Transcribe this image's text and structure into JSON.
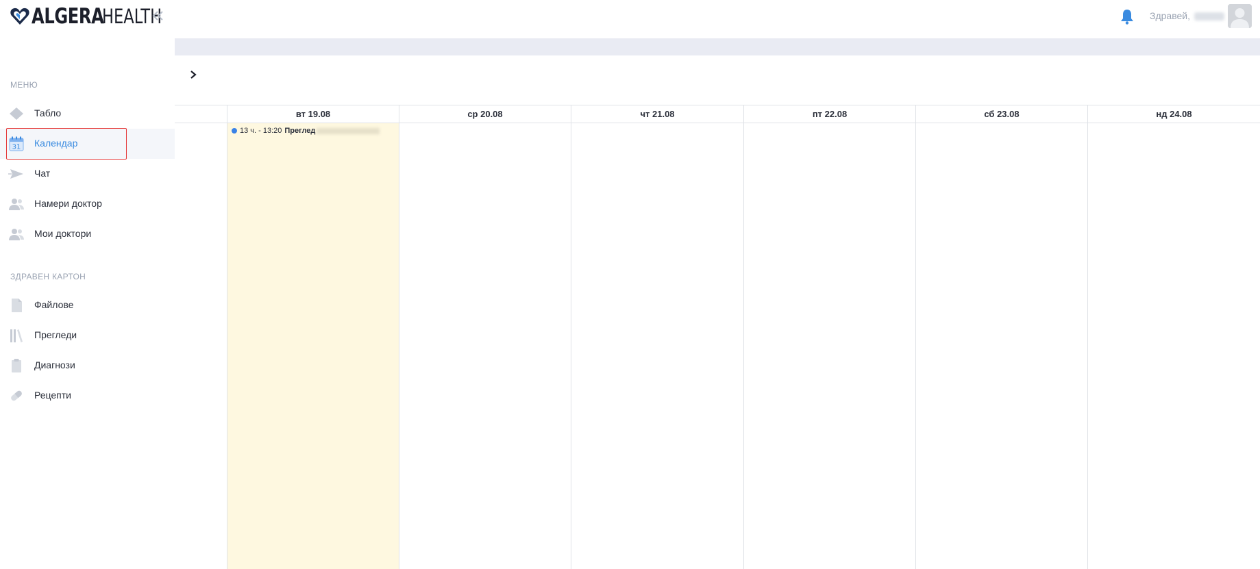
{
  "app": {
    "logo_bold": "ALGERA",
    "logo_light": "HEALTH"
  },
  "header": {
    "greeting": "Здравей,"
  },
  "sidebar": {
    "menu_title": "МЕНЮ",
    "items": [
      {
        "label": "Табло",
        "icon": "diamond-icon"
      },
      {
        "label": "Календар",
        "icon": "calendar-icon",
        "active": true
      },
      {
        "label": "Чат",
        "icon": "send-icon"
      },
      {
        "label": "Намери доктор",
        "icon": "people-icon"
      },
      {
        "label": "Мои доктори",
        "icon": "people-icon"
      }
    ],
    "health_title": "ЗДРАВЕН КАРТОН",
    "health_items": [
      {
        "label": "Файлове",
        "icon": "file-icon"
      },
      {
        "label": "Прегледи",
        "icon": "books-icon"
      },
      {
        "label": "Диагнози",
        "icon": "clipboard-icon"
      },
      {
        "label": "Рецепти",
        "icon": "pill-icon"
      }
    ],
    "calendar_icon_text": "31"
  },
  "calendar": {
    "days": [
      {
        "label": "вт 19.08",
        "today": true
      },
      {
        "label": "ср 20.08",
        "today": false
      },
      {
        "label": "чт 21.08",
        "today": false
      },
      {
        "label": "пт 22.08",
        "today": false
      },
      {
        "label": "сб 23.08",
        "today": false
      },
      {
        "label": "нд 24.08",
        "today": false
      }
    ],
    "event": {
      "time": "13 ч. - 13:20",
      "title": "Преглед"
    }
  },
  "colors": {
    "accent": "#3a8be0",
    "today_bg": "#fef8e0",
    "highlight": "#e53b3b"
  }
}
